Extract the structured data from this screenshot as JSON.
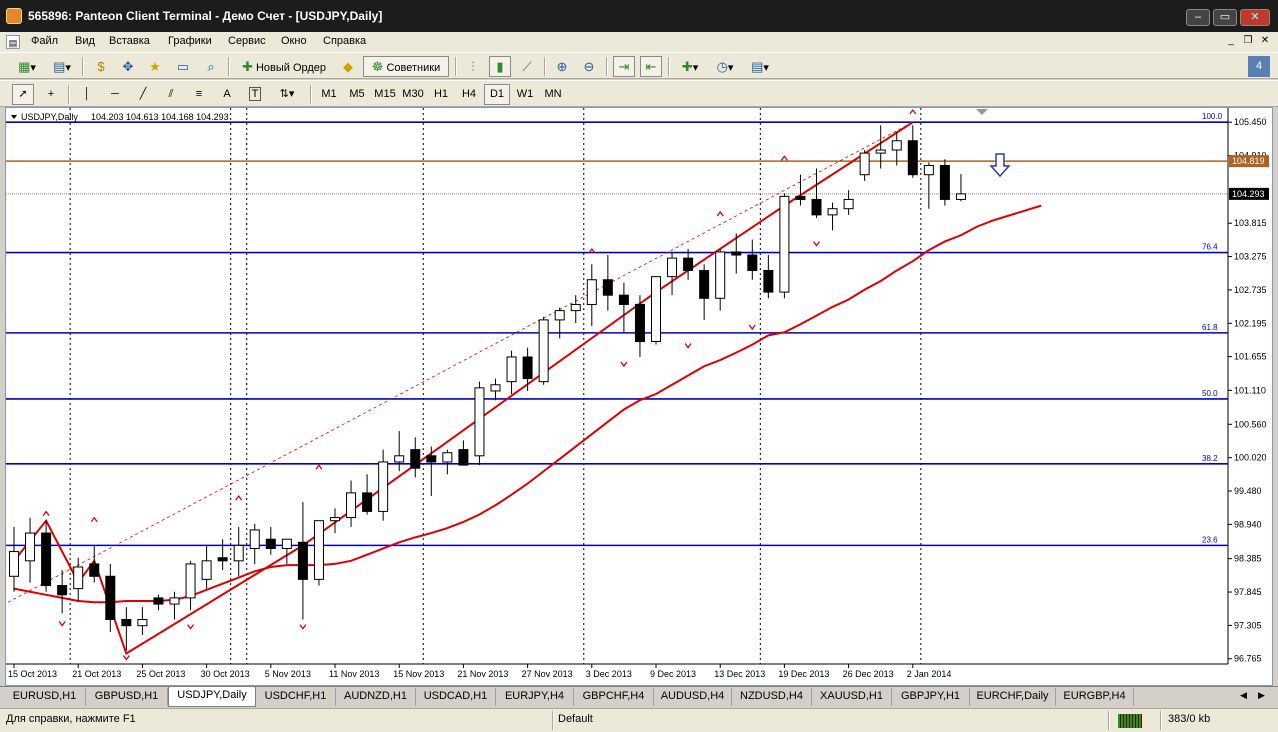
{
  "window": {
    "title": "565896: Panteon Client Terminal - Демо Счет - [USDJPY,Daily]"
  },
  "menu": [
    "Файл",
    "Вид",
    "Вставка",
    "Графики",
    "Сервис",
    "Окно",
    "Справка"
  ],
  "toolbar": {
    "new_order_label": "Новый Ордер",
    "advisors_label": "Советники"
  },
  "draw_tools": {
    "text_tool": "A",
    "label_tool": "T"
  },
  "timeframes": [
    "M1",
    "M5",
    "M15",
    "M30",
    "H1",
    "H4",
    "D1",
    "W1",
    "MN"
  ],
  "active_timeframe": "D1",
  "chart_data": {
    "type": "candlestick",
    "symbol_label": "USDJPY,Daily",
    "ohlc_label": "104.203 104.613 104.168 104.293",
    "y_ticks": [
      "105.450",
      "104.910",
      "103.815",
      "103.275",
      "102.735",
      "102.195",
      "101.655",
      "101.110",
      "100.560",
      "100.020",
      "99.480",
      "98.940",
      "98.385",
      "97.845",
      "97.305",
      "96.765"
    ],
    "x_ticks": [
      "15 Oct 2013",
      "21 Oct 2013",
      "25 Oct 2013",
      "30 Oct 2013",
      "5 Nov 2013",
      "11 Nov 2013",
      "15 Nov 2013",
      "21 Nov 2013",
      "27 Nov 2013",
      "3 Dec 2013",
      "9 Dec 2013",
      "13 Dec 2013",
      "19 Dec 2013",
      "26 Dec 2013",
      "2 Jan 2014"
    ],
    "ylim": [
      96.68,
      105.68
    ],
    "fibo_levels": [
      {
        "label": "100.0",
        "price": 105.45
      },
      {
        "label": "76.4",
        "price": 103.34
      },
      {
        "label": "61.8",
        "price": 102.04
      },
      {
        "label": "50.0",
        "price": 100.97
      },
      {
        "label": "38.2",
        "price": 99.92
      },
      {
        "label": "23.6",
        "price": 98.6
      }
    ],
    "horizontal_line": {
      "label": "104.819",
      "price": 104.82
    },
    "price_label": "104.293",
    "candles": [
      {
        "o": 98.1,
        "h": 98.9,
        "l": 97.85,
        "c": 98.5
      },
      {
        "o": 98.35,
        "h": 99.05,
        "l": 98.0,
        "c": 98.8
      },
      {
        "o": 98.8,
        "h": 99.0,
        "l": 97.85,
        "c": 97.95
      },
      {
        "o": 97.95,
        "h": 98.2,
        "l": 97.5,
        "c": 97.8
      },
      {
        "o": 97.9,
        "h": 98.4,
        "l": 97.7,
        "c": 98.25
      },
      {
        "o": 98.3,
        "h": 98.6,
        "l": 98.0,
        "c": 98.1
      },
      {
        "o": 98.1,
        "h": 98.3,
        "l": 97.2,
        "c": 97.4
      },
      {
        "o": 97.4,
        "h": 97.6,
        "l": 96.9,
        "c": 97.3
      },
      {
        "o": 97.3,
        "h": 97.6,
        "l": 97.15,
        "c": 97.4
      },
      {
        "o": 97.75,
        "h": 97.8,
        "l": 97.55,
        "c": 97.65
      },
      {
        "o": 97.65,
        "h": 97.85,
        "l": 97.4,
        "c": 97.75
      },
      {
        "o": 97.75,
        "h": 98.35,
        "l": 97.55,
        "c": 98.3
      },
      {
        "o": 98.05,
        "h": 98.6,
        "l": 97.9,
        "c": 98.35
      },
      {
        "o": 98.4,
        "h": 98.7,
        "l": 98.2,
        "c": 98.35
      },
      {
        "o": 98.35,
        "h": 98.9,
        "l": 98.1,
        "c": 98.6
      },
      {
        "o": 98.55,
        "h": 98.95,
        "l": 98.3,
        "c": 98.85
      },
      {
        "o": 98.7,
        "h": 98.9,
        "l": 98.45,
        "c": 98.55
      },
      {
        "o": 98.55,
        "h": 98.7,
        "l": 98.3,
        "c": 98.7
      },
      {
        "o": 98.65,
        "h": 99.3,
        "l": 97.4,
        "c": 98.05
      },
      {
        "o": 98.05,
        "h": 99.0,
        "l": 97.95,
        "c": 99.0
      },
      {
        "o": 99.0,
        "h": 99.2,
        "l": 98.8,
        "c": 99.05
      },
      {
        "o": 99.05,
        "h": 99.65,
        "l": 98.9,
        "c": 99.45
      },
      {
        "o": 99.45,
        "h": 99.75,
        "l": 99.1,
        "c": 99.15
      },
      {
        "o": 99.15,
        "h": 100.15,
        "l": 99.0,
        "c": 99.95
      },
      {
        "o": 99.95,
        "h": 100.45,
        "l": 99.8,
        "c": 100.05
      },
      {
        "o": 100.15,
        "h": 100.35,
        "l": 99.7,
        "c": 99.85
      },
      {
        "o": 100.05,
        "h": 100.2,
        "l": 99.4,
        "c": 99.95
      },
      {
        "o": 99.95,
        "h": 100.15,
        "l": 99.75,
        "c": 100.1
      },
      {
        "o": 100.15,
        "h": 100.3,
        "l": 99.9,
        "c": 99.9
      },
      {
        "o": 100.05,
        "h": 101.25,
        "l": 99.9,
        "c": 101.15
      },
      {
        "o": 101.1,
        "h": 101.3,
        "l": 100.95,
        "c": 101.2
      },
      {
        "o": 101.25,
        "h": 101.75,
        "l": 101.05,
        "c": 101.65
      },
      {
        "o": 101.65,
        "h": 101.8,
        "l": 101.1,
        "c": 101.3
      },
      {
        "o": 101.25,
        "h": 102.3,
        "l": 101.2,
        "c": 102.25
      },
      {
        "o": 102.25,
        "h": 102.45,
        "l": 101.95,
        "c": 102.4
      },
      {
        "o": 102.4,
        "h": 102.65,
        "l": 102.2,
        "c": 102.5
      },
      {
        "o": 102.5,
        "h": 103.15,
        "l": 102.15,
        "c": 102.9
      },
      {
        "o": 102.9,
        "h": 103.3,
        "l": 102.4,
        "c": 102.65
      },
      {
        "o": 102.65,
        "h": 102.85,
        "l": 102.05,
        "c": 102.5
      },
      {
        "o": 102.5,
        "h": 102.65,
        "l": 101.65,
        "c": 101.9
      },
      {
        "o": 101.9,
        "h": 102.8,
        "l": 101.85,
        "c": 102.95
      },
      {
        "o": 102.95,
        "h": 103.35,
        "l": 102.65,
        "c": 103.25
      },
      {
        "o": 103.25,
        "h": 103.4,
        "l": 102.9,
        "c": 103.05
      },
      {
        "o": 103.05,
        "h": 103.15,
        "l": 102.25,
        "c": 102.6
      },
      {
        "o": 102.6,
        "h": 103.4,
        "l": 102.4,
        "c": 103.35
      },
      {
        "o": 103.35,
        "h": 103.65,
        "l": 103.0,
        "c": 103.3
      },
      {
        "o": 103.3,
        "h": 103.55,
        "l": 102.9,
        "c": 103.05
      },
      {
        "o": 103.05,
        "h": 103.3,
        "l": 102.6,
        "c": 102.7
      },
      {
        "o": 102.7,
        "h": 104.3,
        "l": 102.6,
        "c": 104.25
      },
      {
        "o": 104.25,
        "h": 104.6,
        "l": 104.1,
        "c": 104.2
      },
      {
        "o": 104.2,
        "h": 104.7,
        "l": 103.9,
        "c": 103.95
      },
      {
        "o": 103.95,
        "h": 104.15,
        "l": 103.7,
        "c": 104.05
      },
      {
        "o": 104.05,
        "h": 104.35,
        "l": 103.95,
        "c": 104.2
      },
      {
        "o": 104.6,
        "h": 105.0,
        "l": 104.5,
        "c": 104.95
      },
      {
        "o": 104.95,
        "h": 105.4,
        "l": 104.7,
        "c": 105.0
      },
      {
        "o": 105.0,
        "h": 105.3,
        "l": 104.75,
        "c": 105.15
      },
      {
        "o": 105.15,
        "h": 105.4,
        "l": 104.55,
        "c": 104.6
      },
      {
        "o": 104.6,
        "h": 104.8,
        "l": 104.05,
        "c": 104.75
      },
      {
        "o": 104.75,
        "h": 104.85,
        "l": 104.1,
        "c": 104.2
      },
      {
        "o": 104.2,
        "h": 104.61,
        "l": 104.17,
        "c": 104.29
      }
    ],
    "red_ma": [
      97.9,
      97.85,
      97.8,
      97.75,
      97.7,
      97.68,
      97.68,
      97.7,
      97.7,
      97.7,
      97.72,
      97.78,
      97.88,
      97.98,
      98.08,
      98.18,
      98.25,
      98.28,
      98.28,
      98.28,
      98.3,
      98.35,
      98.45,
      98.55,
      98.65,
      98.73,
      98.8,
      98.88,
      98.98,
      99.1,
      99.25,
      99.42,
      99.6,
      99.8,
      100.0,
      100.2,
      100.4,
      100.6,
      100.8,
      100.95,
      101.05,
      101.2,
      101.35,
      101.5,
      101.6,
      101.72,
      101.85,
      102.0,
      102.05,
      102.18,
      102.32,
      102.46,
      102.58,
      102.74,
      102.88,
      103.05,
      103.2,
      103.38,
      103.52,
      103.62,
      103.76,
      103.86,
      103.94,
      104.02,
      104.1
    ]
  },
  "symbol_tabs": [
    "EURUSD,H1",
    "GBPUSD,H1",
    "USDJPY,Daily",
    "USDCHF,H1",
    "AUDNZD,H1",
    "USDCAD,H1",
    "EURJPY,H4",
    "GBPCHF,H4",
    "AUDUSD,H4",
    "NZDUSD,H4",
    "XAUUSD,H1",
    "GBPJPY,H1",
    "EURCHF,Daily",
    "EURGBP,H4"
  ],
  "active_tab": "USDJPY,Daily",
  "status": {
    "help": "Для справки, нажмите F1",
    "profile": "Default",
    "traffic": "383/0 kb"
  },
  "colors": {
    "fibo": "#0000cc",
    "ma": "#dd0000",
    "hline": "#b06020",
    "candle_bear": "#000000",
    "candle_bull": "#ffffff"
  }
}
